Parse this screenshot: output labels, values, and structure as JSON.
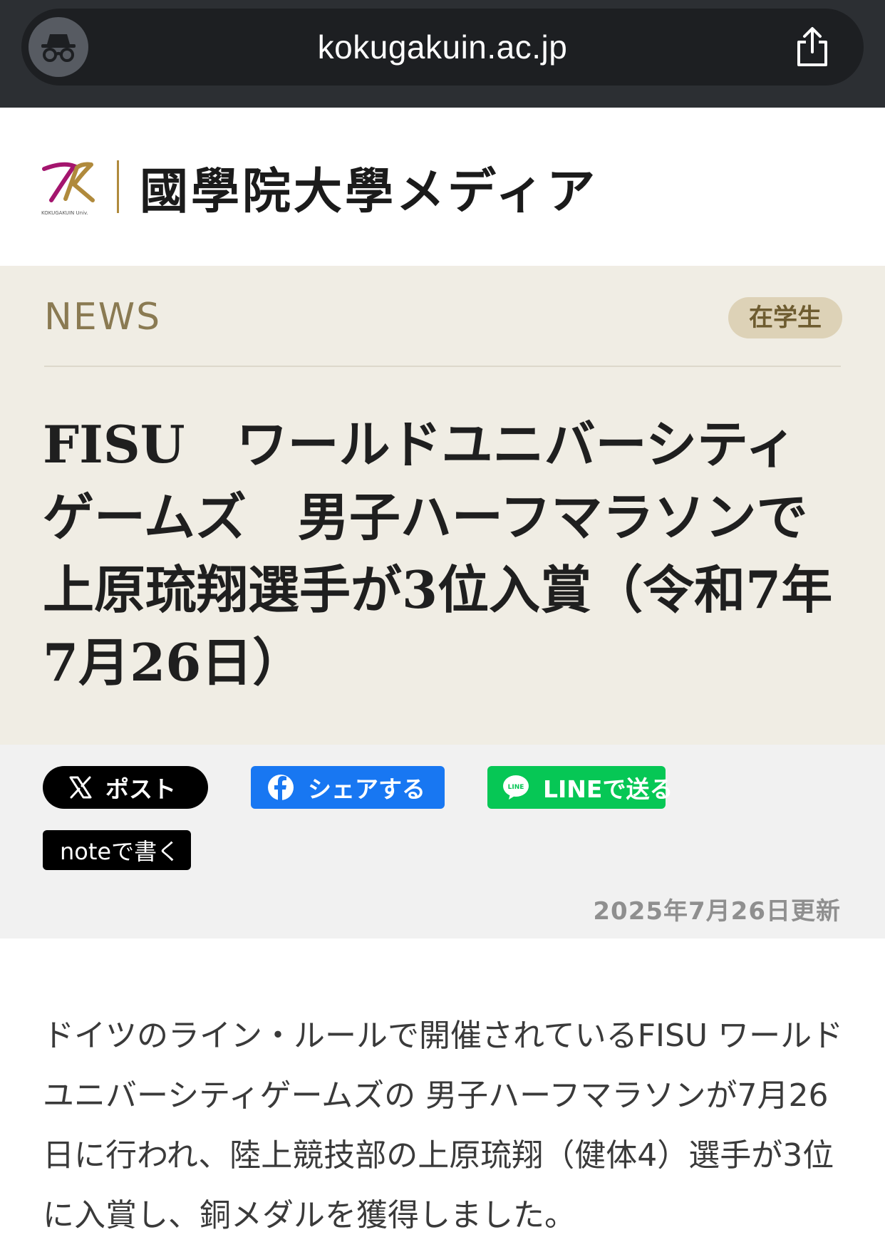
{
  "browser": {
    "url": "kokugakuin.ac.jp",
    "incognito_icon": "incognito-icon",
    "share_icon": "share-icon"
  },
  "site": {
    "logo_text": "KOKUGAKUIN Univ.",
    "title": "國學院大學メディア"
  },
  "article": {
    "section_label": "NEWS",
    "category": "在学生",
    "headline": "FISU　ワールドユニバーシティゲームズ　男子ハーフマラソンで上原琉翔選手が3位入賞（令和7年7月26日）",
    "updated": "2025年7月26日更新",
    "body": "ドイツのライン・ルールで開催されているFISU ワールドユニバーシティゲームズの 男子ハーフマラソンが7月26日に行われ、陸上競技部の上原琉翔（健体4）選手が3位に入賞し、銅メダルを獲得しました。"
  },
  "share": {
    "x_label": "ポスト",
    "facebook_label": "シェアする",
    "line_label": "LINEで送る",
    "note_label": "noteで書く"
  },
  "colors": {
    "hero_bg": "#f0ede4",
    "accent_gold": "#8a7a52",
    "badge_bg": "#ddd2b7",
    "facebook": "#1877f2",
    "line": "#06c755",
    "x": "#000000"
  }
}
